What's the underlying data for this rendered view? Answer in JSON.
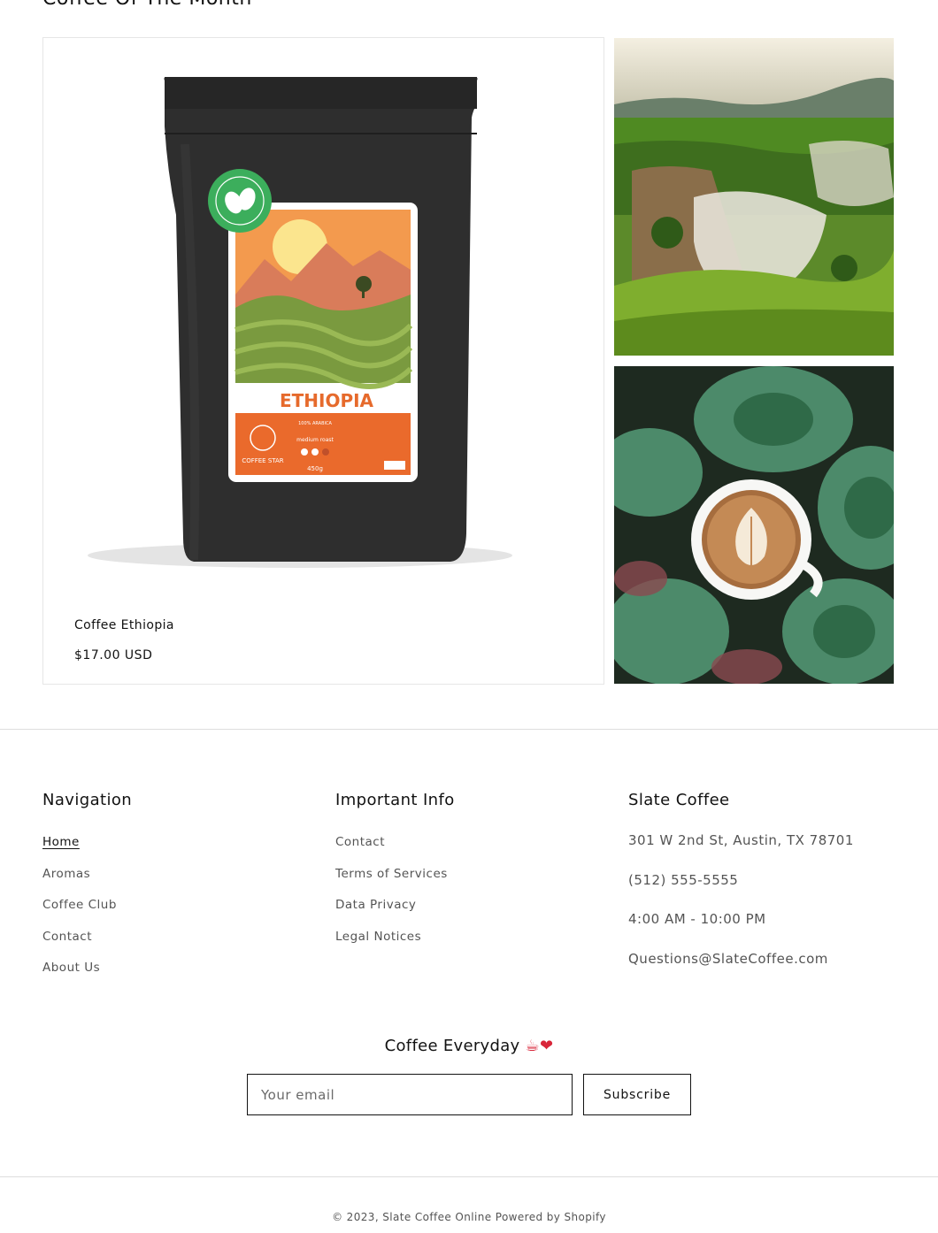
{
  "featured": {
    "section_title": "Coffee Of The Month",
    "product": {
      "name": "Coffee Ethiopia",
      "price": "$17.00 USD",
      "bag_label": "ETHIOPIA",
      "bag_brand": "COFFEE STAR",
      "bag_weight": "450g",
      "bag_type": "100% ARABICA",
      "bag_roast": "medium roast"
    }
  },
  "footer": {
    "navigation": {
      "heading": "Navigation",
      "links": [
        "Home",
        "Aromas",
        "Coffee Club",
        "Contact",
        "About Us"
      ]
    },
    "important_info": {
      "heading": "Important Info",
      "links": [
        "Contact",
        "Terms of Services",
        "Data Privacy",
        "Legal Notices"
      ]
    },
    "store": {
      "heading": "Slate Coffee",
      "address": "301 W 2nd St, Austin, TX 78701",
      "phone": "(512) 555-5555",
      "hours": "4:00 AM - 10:00 PM",
      "email": "Questions@SlateCoffee.com"
    },
    "newsletter": {
      "title": "Coffee Everyday",
      "title_emoji": "☕❤",
      "email_placeholder": "Your email",
      "button_label": "Subscribe"
    },
    "copyright": {
      "prefix": "© 2023,",
      "store_link": "Slate Coffee Online",
      "powered": "Powered by Shopify"
    }
  }
}
